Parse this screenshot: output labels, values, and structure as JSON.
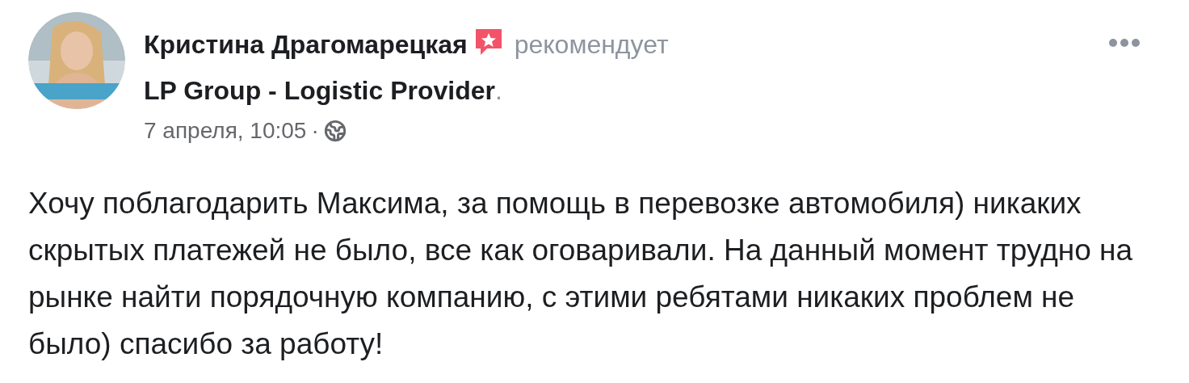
{
  "post": {
    "author": "Кристина Драгомарецкая",
    "action": "рекомендует",
    "page": "LP Group - Logistic Provider",
    "trailing": ".",
    "timestamp": "7 апреля, 10:05",
    "separator": "·",
    "body": "Хочу поблагодарить Максима, за помощь в перевозке автомобиля) никаких скрытых платежей не было, все как оговаривали. На данный момент трудно на рынке найти порядочную компанию, с этими ребятами никаких проблем не было) спасибо за работу!"
  }
}
